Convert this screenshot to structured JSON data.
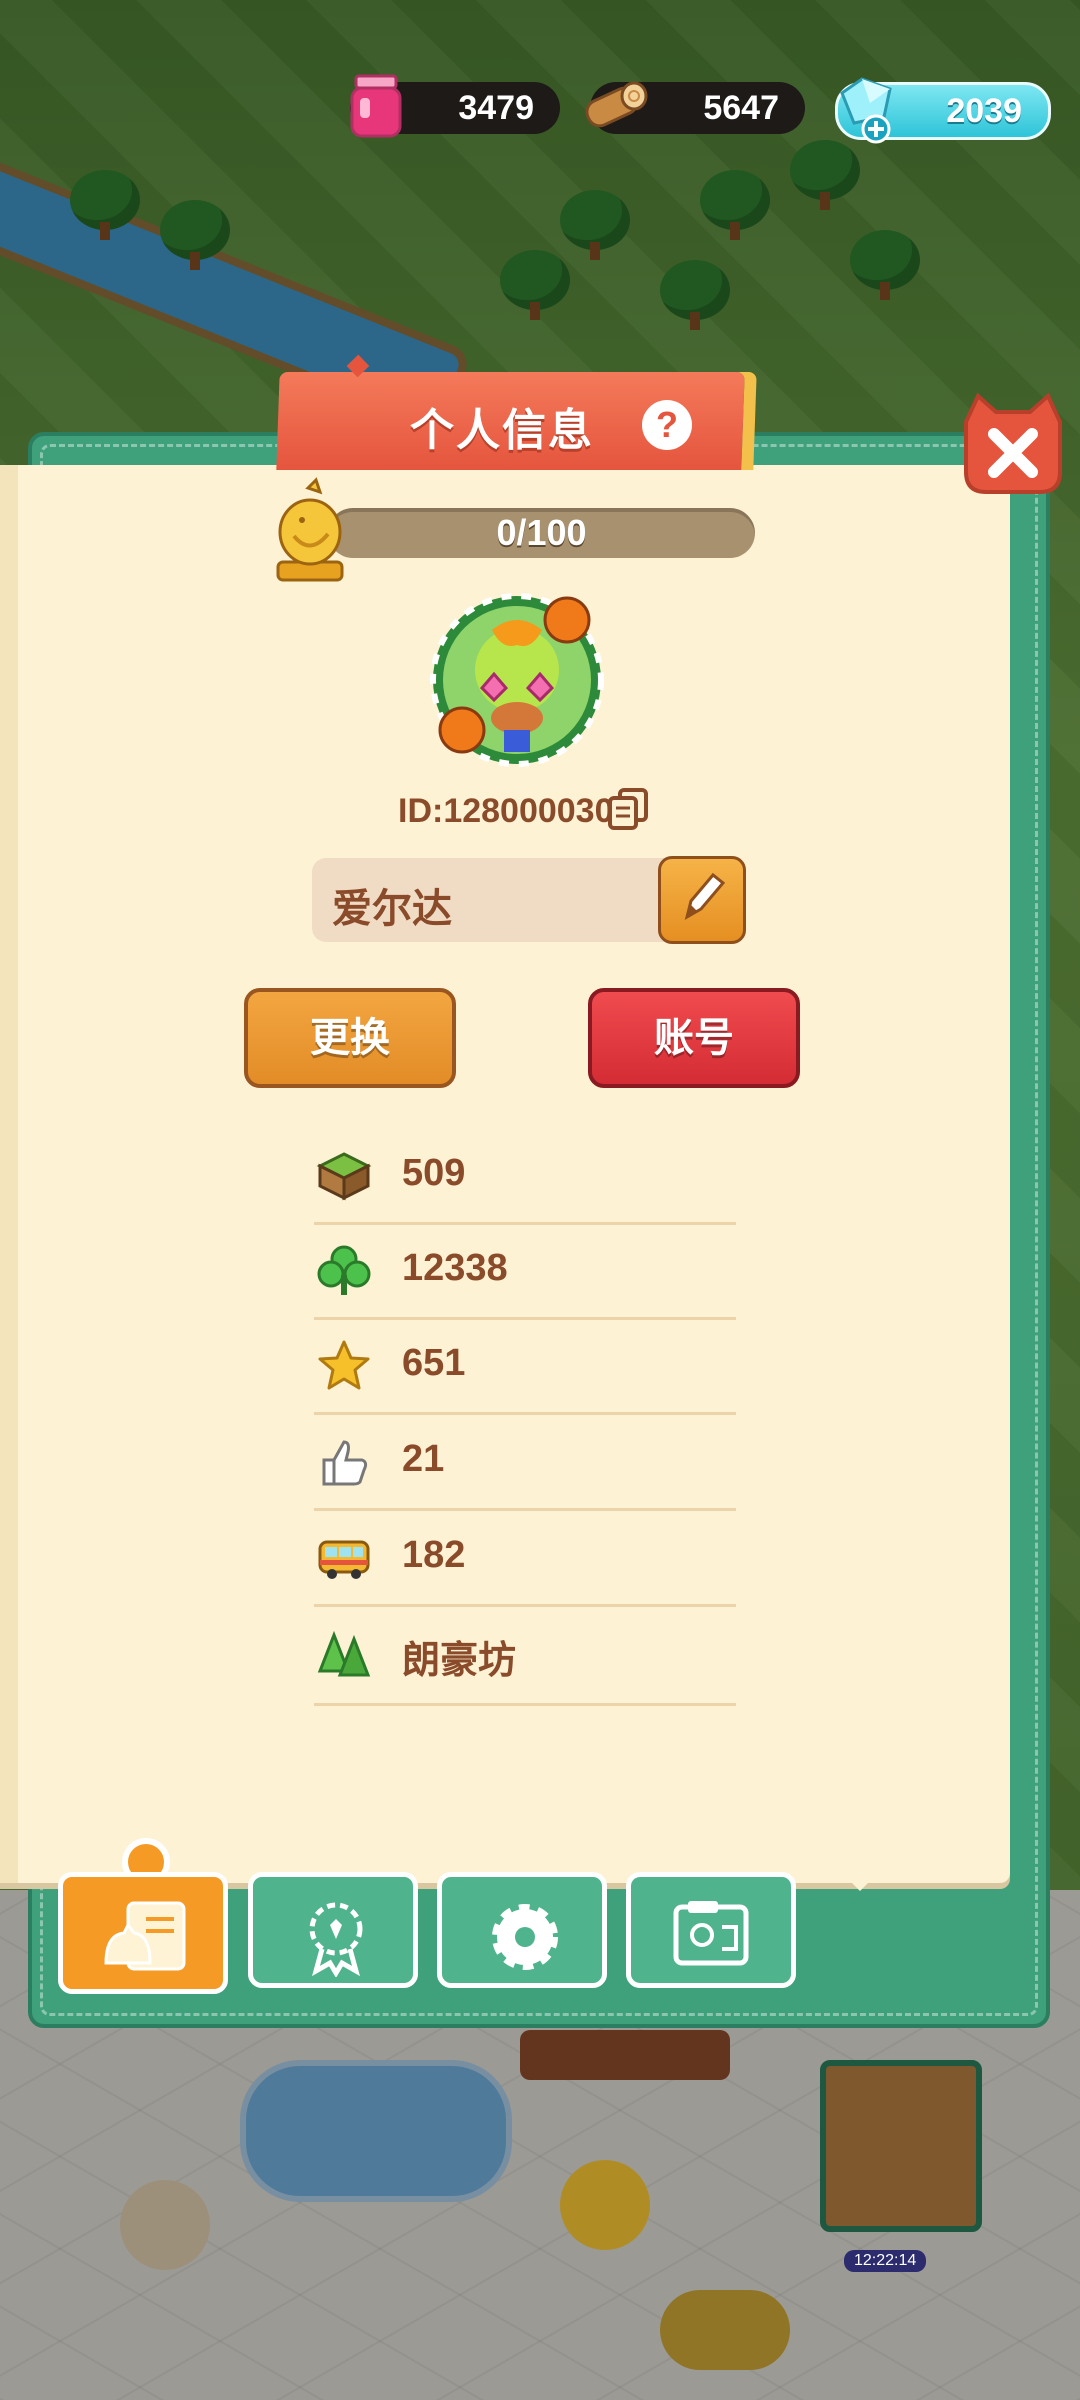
{
  "resources": {
    "jam": {
      "value": "3479",
      "icon": "jam-jar-icon",
      "color": "#e8367a"
    },
    "wood": {
      "value": "5647",
      "icon": "wood-log-icon",
      "color": "#c98a43"
    },
    "gems": {
      "value": "2039",
      "icon": "gem-icon",
      "color": "#5fd6e6"
    }
  },
  "panel": {
    "title": "个人信息",
    "help_label": "?",
    "close_icon": "close-icon",
    "progress": {
      "text": "0/100",
      "fraction": 0
    },
    "player_id": "ID:128000030",
    "name": "爱尔达",
    "buttons": {
      "change": "更换",
      "account": "账号"
    },
    "stats": [
      {
        "icon": "land-tile-icon",
        "value": "509"
      },
      {
        "icon": "clover-icon",
        "value": "12338"
      },
      {
        "icon": "star-icon",
        "value": "651"
      },
      {
        "icon": "thumbs-up-icon",
        "value": "21"
      },
      {
        "icon": "bus-icon",
        "value": "182"
      },
      {
        "icon": "trees-icon",
        "value": "朗豪坊"
      }
    ]
  },
  "tabs": [
    {
      "name": "profile",
      "icon": "profile-card-icon",
      "active": true
    },
    {
      "name": "badge",
      "icon": "badge-icon",
      "active": false
    },
    {
      "name": "settings",
      "icon": "gear-icon",
      "active": false
    },
    {
      "name": "album",
      "icon": "photo-album-icon",
      "active": false
    }
  ],
  "timer": "12:22:14",
  "colors": {
    "accent_orange": "#f49a25",
    "accent_red": "#e5553e",
    "panel_green": "#3fa07c",
    "text_brown": "#8a4b2a"
  }
}
